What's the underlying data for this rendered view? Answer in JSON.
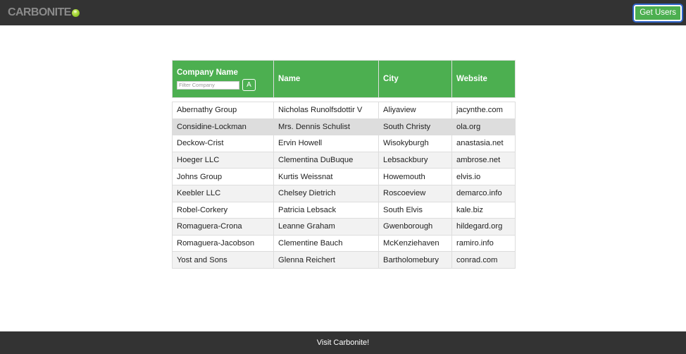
{
  "header": {
    "logo_text": "CARBONITE",
    "get_users_label": "Get Users"
  },
  "table": {
    "columns": [
      "Company Name",
      "Name",
      "City",
      "Website"
    ],
    "filter_placeholder": "Filter Company",
    "sort_label": "A",
    "rows": [
      [
        "Abernathy Group",
        "Nicholas Runolfsdottir V",
        "Aliyaview",
        "jacynthe.com"
      ],
      [
        "Considine-Lockman",
        "Mrs. Dennis Schulist",
        "South Christy",
        "ola.org"
      ],
      [
        "Deckow-Crist",
        "Ervin Howell",
        "Wisokyburgh",
        "anastasia.net"
      ],
      [
        "Hoeger LLC",
        "Clementina DuBuque",
        "Lebsackbury",
        "ambrose.net"
      ],
      [
        "Johns Group",
        "Kurtis Weissnat",
        "Howemouth",
        "elvis.io"
      ],
      [
        "Keebler LLC",
        "Chelsey Dietrich",
        "Roscoeview",
        "demarco.info"
      ],
      [
        "Robel-Corkery",
        "Patricia Lebsack",
        "South Elvis",
        "kale.biz"
      ],
      [
        "Romaguera-Crona",
        "Leanne Graham",
        "Gwenborough",
        "hildegard.org"
      ],
      [
        "Romaguera-Jacobson",
        "Clementine Bauch",
        "McKenziehaven",
        "ramiro.info"
      ],
      [
        "Yost and Sons",
        "Glenna Reichert",
        "Bartholomebury",
        "conrad.com"
      ]
    ]
  },
  "footer": {
    "link_label": "Visit Carbonite!"
  },
  "colors": {
    "header_bg": "#333333",
    "accent_green": "#4caf50",
    "row_alt": "#f2f2f2",
    "row_hover": "#dddddd"
  }
}
